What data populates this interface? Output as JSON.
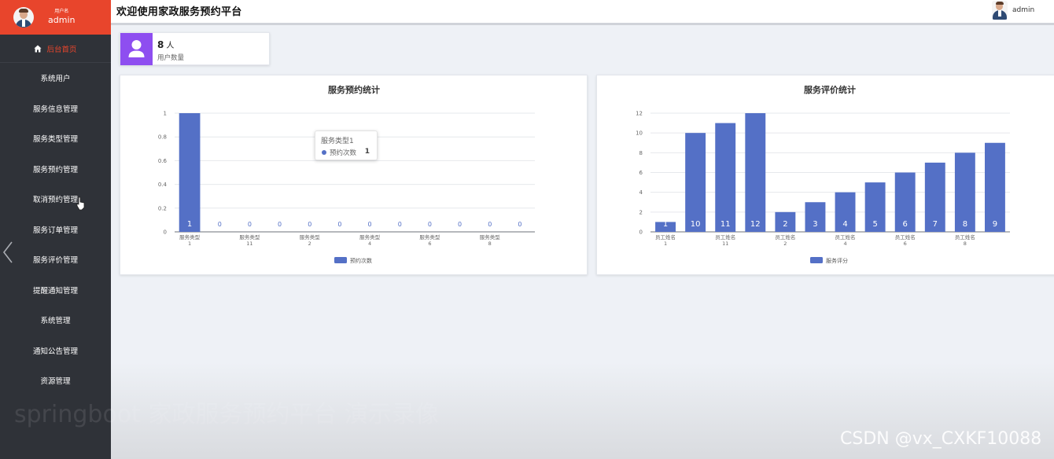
{
  "sidebar": {
    "user_label": "用户名",
    "user_name": "admin",
    "home_label": "后台首页",
    "items": [
      {
        "label": "系统用户"
      },
      {
        "label": "服务信息管理"
      },
      {
        "label": "服务类型管理"
      },
      {
        "label": "服务预约管理"
      },
      {
        "label": "取消预约管理"
      },
      {
        "label": "服务订单管理"
      },
      {
        "label": "服务评价管理"
      },
      {
        "label": "提醒通知管理"
      },
      {
        "label": "系统管理"
      },
      {
        "label": "通知公告管理"
      },
      {
        "label": "资源管理"
      }
    ],
    "icons": [
      "home-icon",
      "chevron-left-icon"
    ],
    "accent_color": "#e8452c",
    "bg_color": "#2f3238"
  },
  "header": {
    "title": "欢迎使用家政服务预约平台",
    "user_name": "admin"
  },
  "stat": {
    "count": "8",
    "unit": "人",
    "label": "用户数量",
    "icon": "user-icon",
    "icon_color": "#8e4ef0"
  },
  "tooltip": {
    "title": "服务类型1",
    "series": "预约次数",
    "value": "1"
  },
  "chart_data": [
    {
      "type": "bar",
      "title": "服务预约统计",
      "categories": [
        "服务类型1",
        "服务类型11",
        "服务类型2",
        "服务类型4",
        "服务类型6",
        "服务类型8"
      ],
      "category_labels": [
        {
          "top": "服务类型",
          "bottom": "1"
        },
        {
          "top": "服务类型",
          "bottom": "11"
        },
        {
          "top": "服务类型",
          "bottom": "2"
        },
        {
          "top": "服务类型",
          "bottom": "4"
        },
        {
          "top": "服务类型",
          "bottom": "6"
        },
        {
          "top": "服务类型",
          "bottom": "8"
        }
      ],
      "bar_count": 12,
      "label_every": 2,
      "series": [
        {
          "name": "预约次数",
          "values": [
            1,
            0,
            0,
            0,
            0,
            0,
            0,
            0,
            0,
            0,
            0,
            0
          ]
        }
      ],
      "ylim": [
        0,
        1
      ],
      "yticks": [
        "0",
        "0.2",
        "0.4",
        "0.6",
        "0.8",
        "1"
      ],
      "grid": true,
      "legend": "bottom-center",
      "color": "#5470c6"
    },
    {
      "type": "bar",
      "title": "服务评价统计",
      "categories": [
        "员工姓名1",
        "员工姓名11",
        "员工姓名2",
        "员工姓名4",
        "员工姓名6",
        "员工姓名8"
      ],
      "category_labels": [
        {
          "top": "员工姓名",
          "bottom": "1"
        },
        {
          "top": "员工姓名",
          "bottom": "11"
        },
        {
          "top": "员工姓名",
          "bottom": "2"
        },
        {
          "top": "员工姓名",
          "bottom": "4"
        },
        {
          "top": "员工姓名",
          "bottom": "6"
        },
        {
          "top": "员工姓名",
          "bottom": "8"
        }
      ],
      "bar_count": 12,
      "label_every": 2,
      "series": [
        {
          "name": "服务评分",
          "values": [
            1,
            10,
            11,
            12,
            2,
            3,
            4,
            5,
            6,
            7,
            8,
            9
          ]
        }
      ],
      "ylim": [
        0,
        12
      ],
      "yticks": [
        "0",
        "2",
        "4",
        "6",
        "8",
        "10",
        "12"
      ],
      "grid": true,
      "legend": "bottom-center",
      "color": "#5470c6"
    }
  ],
  "overlay": {
    "watermark": "springboot 家政服务预约平台 演示录像",
    "csdn": "CSDN @vx_CXKF10088"
  }
}
